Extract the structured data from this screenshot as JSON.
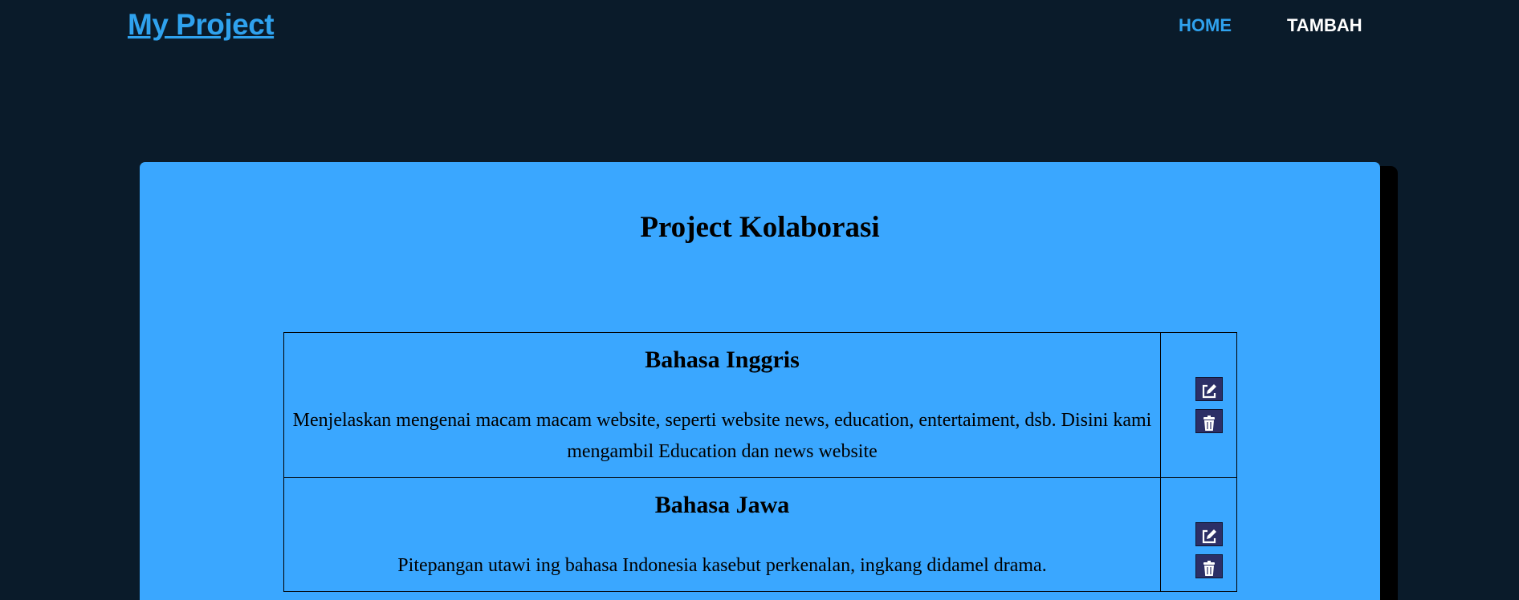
{
  "header": {
    "brand": "My Project",
    "nav": [
      {
        "label": "HOME"
      },
      {
        "label": "TAMBAH"
      }
    ]
  },
  "main": {
    "title": "Project Kolaborasi",
    "projects": [
      {
        "title": "Bahasa Inggris",
        "description": "Menjelaskan mengenai macam macam website, seperti website news, education, entertaiment, dsb. Disini kami mengambil Education dan news website"
      },
      {
        "title": "Bahasa Jawa",
        "description": "Pitepangan utawi ing bahasa Indonesia kasebut perkenalan, ingkang didamel drama."
      }
    ]
  },
  "icons": {
    "edit": "edit-icon",
    "delete": "trash-icon"
  },
  "colors": {
    "background": "#0a1b2a",
    "accent": "#2fa2ee",
    "card": "#3aa7ff",
    "button": "#2c2f66"
  }
}
